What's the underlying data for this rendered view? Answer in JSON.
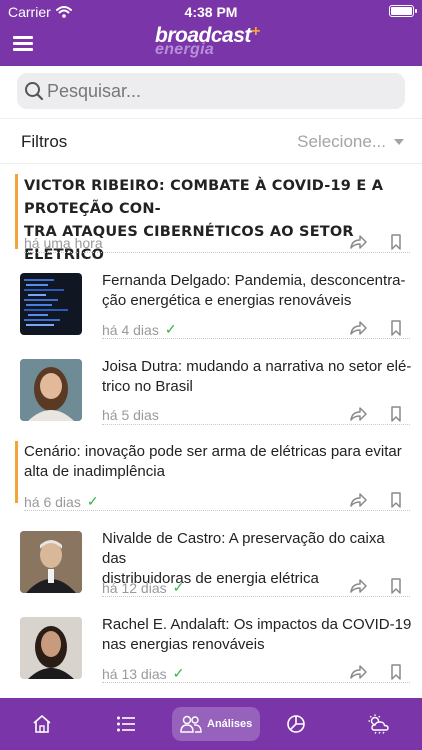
{
  "status_bar": {
    "carrier": "Carrier",
    "time": "4:38 PM"
  },
  "header": {
    "logo_main": "broadcast",
    "logo_sub": "energia",
    "logo_mark": "+"
  },
  "search": {
    "placeholder": "Pesquisar..."
  },
  "filters": {
    "label": "Filtros",
    "select_value": "Selecione..."
  },
  "articles": [
    {
      "title": "VICTOR RIBEIRO: COMBATE À COVID-19 E A PROTEÇÃO CON-\nTRA ATAQUES CIBERNÉTICOS AO SETOR ELÉTRICO",
      "time": "há uma hora",
      "read": false,
      "highlight": true
    },
    {
      "title": "Fernanda Delgado: Pandemia, desconcentra-\nção energética e energias renováveis",
      "time": "há 4 dias",
      "read": true
    },
    {
      "title": "Joisa Dutra: mudando a narrativa no setor elé-\ntrico no Brasil",
      "time": "há 5 dias",
      "read": false
    },
    {
      "title": "Cenário: inovação pode ser arma de elétricas para evitar\nalta de inadimplência",
      "time": "há 6 dias",
      "read": true,
      "highlight": true
    },
    {
      "title": "Nivalde de Castro: A preservação do caixa das\ndistribuidoras de energia elétrica",
      "time": "há 12 dias",
      "read": true
    },
    {
      "title": "Rachel E. Andalaft: Os impactos da COVID-19\nnas energias renováveis",
      "time": "há 13 dias",
      "read": true
    }
  ],
  "tabbar": {
    "active_label": "Análises"
  },
  "colors": {
    "brand_purple": "#7a36a8",
    "accent_orange": "#f2a33a",
    "read_check": "#39b24a"
  },
  "icons": [
    "wifi-icon",
    "battery-icon",
    "hamburger-menu-icon",
    "search-icon",
    "caret-down-icon",
    "share-icon",
    "bookmark-icon",
    "check-icon",
    "home-icon",
    "list-icon",
    "people-icon",
    "pie-chart-icon",
    "weather-icon"
  ]
}
